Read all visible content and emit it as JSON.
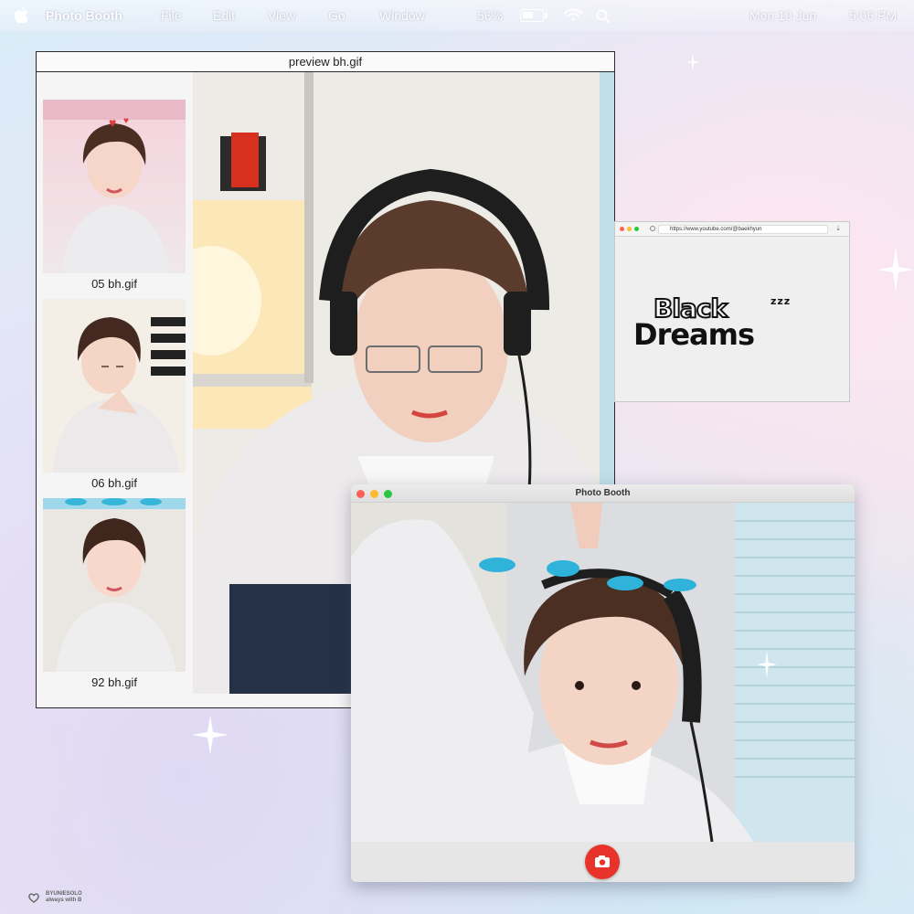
{
  "menubar": {
    "app_name": "Photo Booth",
    "menus": [
      "File",
      "Edit",
      "View",
      "Go",
      "Window"
    ],
    "battery_percent": "56%",
    "battery_level": 0.56,
    "date": "Mon 10 Jun",
    "time": "5:06 PM"
  },
  "preview_window": {
    "title": "preview bh.gif",
    "thumbnails": [
      {
        "caption": "05 bh.gif"
      },
      {
        "caption": "06 bh.gif"
      },
      {
        "caption": "92 bh.gif"
      }
    ]
  },
  "browser": {
    "url": "https://www.youtube.com/@baekhyun",
    "logo_text": "Black Dreams",
    "logo_line1": "Black",
    "logo_line2": "Dreams",
    "logo_zzz": "zzz"
  },
  "photo_booth": {
    "title": "Photo Booth"
  },
  "watermark": {
    "line1": "BYUNIESOLO",
    "line2": "always with B"
  },
  "colors": {
    "shutter": "#e8332a",
    "traffic_close": "#fe5f57",
    "traffic_min": "#febc2e",
    "traffic_max": "#28c840"
  },
  "icons": [
    "apple-icon",
    "battery-icon",
    "wifi-icon",
    "search-icon",
    "camera-icon",
    "heart-icon",
    "sparkle-icon",
    "moon-icon"
  ]
}
